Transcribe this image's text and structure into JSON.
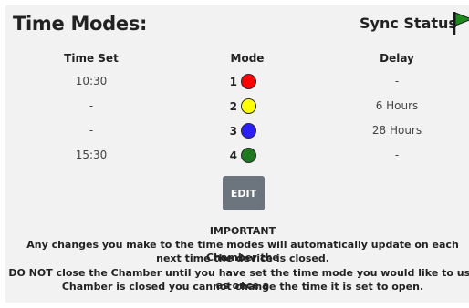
{
  "header": {
    "title": "Time Modes:",
    "sync_label": "Sync Status",
    "sync_flag_color": "#1e8a1e"
  },
  "table": {
    "columns": [
      "Time Set",
      "Mode",
      "Delay"
    ],
    "rows": [
      {
        "time_set": "10:30",
        "mode": "1",
        "color": "#ff0000",
        "delay": "-"
      },
      {
        "time_set": "-",
        "mode": "2",
        "color": "#ffff00",
        "delay": "6 Hours"
      },
      {
        "time_set": "-",
        "mode": "3",
        "color": "#2a1fff",
        "delay": "28 Hours"
      },
      {
        "time_set": "15:30",
        "mode": "4",
        "color": "#1f7a1f",
        "delay": "-"
      }
    ]
  },
  "edit_button": {
    "label": "EDIT"
  },
  "notice": {
    "heading": "IMPORTANT",
    "line1": "Any changes you make to the time modes will automatically update on each Chamber the",
    "line2": "next time the device is closed.",
    "line3": "DO NOT close the Chamber until you have set the time mode you would like to use as once a",
    "line4": "Chamber is closed you cannot change the time it is set to open."
  }
}
